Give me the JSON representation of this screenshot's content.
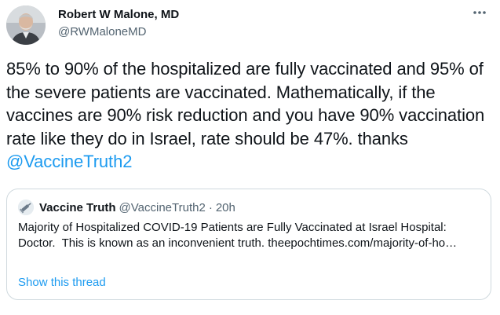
{
  "author": {
    "name": "Robert W Malone, MD",
    "handle": "@RWMaloneMD"
  },
  "icons": {
    "more": "more-horizontal-icon",
    "avatar": "profile-photo"
  },
  "tweet": {
    "text": "85% to 90% of the hospitalized are fully vaccinated and 95% of the severe patients are vaccinated. Mathematically, if the vaccines are 90% risk reduction and you have 90% vaccination rate like they do in Israel, rate should be 47%. thanks ",
    "mention": "@VaccineTruth2"
  },
  "quote": {
    "name": "Vaccine Truth",
    "handle": "@VaccineTruth2",
    "separator": "·",
    "time": "20h",
    "text": "Majority of Hospitalized COVID-19 Patients are Fully Vaccinated at Israel Hospital: Doctor.  This is known as an inconvenient truth. theepochtimes.com/majority-of-ho…",
    "show_thread": "Show this thread"
  },
  "colors": {
    "link": "#1d9bf0",
    "text": "#0f1419",
    "secondary": "#536471",
    "border": "#cfd9de"
  }
}
